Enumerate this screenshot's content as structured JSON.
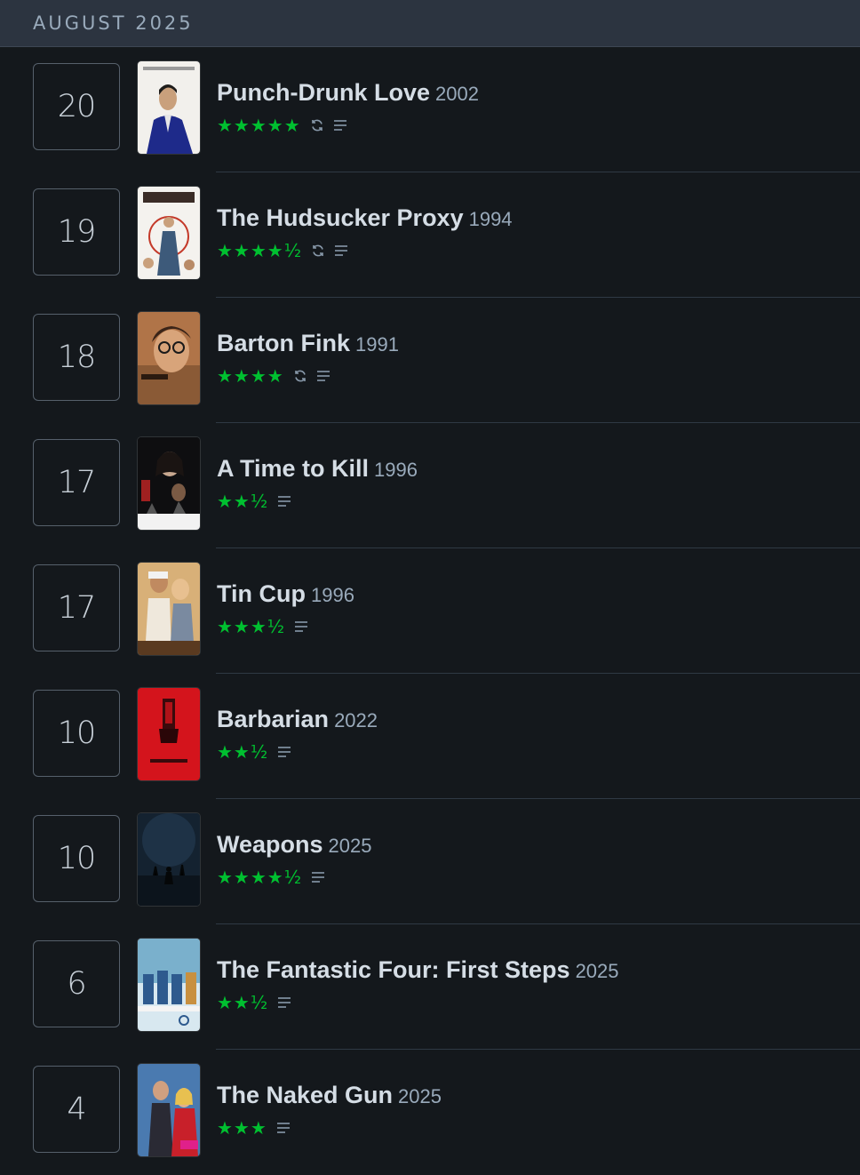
{
  "diary": {
    "month_label": "AUGUST 2025",
    "entries": [
      {
        "day": "20",
        "title": "Punch-Drunk Love",
        "year": "2002",
        "stars": "★★★★★",
        "rating": 5.0,
        "rewatch": true,
        "has_review": true
      },
      {
        "day": "19",
        "title": "The Hudsucker Proxy",
        "year": "1994",
        "stars": "★★★★½",
        "rating": 4.5,
        "rewatch": true,
        "has_review": true
      },
      {
        "day": "18",
        "title": "Barton Fink",
        "year": "1991",
        "stars": "★★★★",
        "rating": 4.0,
        "rewatch": true,
        "has_review": true
      },
      {
        "day": "17",
        "title": "A Time to Kill",
        "year": "1996",
        "stars": "★★½",
        "rating": 2.5,
        "rewatch": false,
        "has_review": true
      },
      {
        "day": "17",
        "title": "Tin Cup",
        "year": "1996",
        "stars": "★★★½",
        "rating": 3.5,
        "rewatch": false,
        "has_review": true
      },
      {
        "day": "10",
        "title": "Barbarian",
        "year": "2022",
        "stars": "★★½",
        "rating": 2.5,
        "rewatch": false,
        "has_review": true
      },
      {
        "day": "10",
        "title": "Weapons",
        "year": "2025",
        "stars": "★★★★½",
        "rating": 4.5,
        "rewatch": false,
        "has_review": true
      },
      {
        "day": "6",
        "title": "The Fantastic Four: First Steps",
        "year": "2025",
        "stars": "★★½",
        "rating": 2.5,
        "rewatch": false,
        "has_review": true
      },
      {
        "day": "4",
        "title": "The Naked Gun",
        "year": "2025",
        "stars": "★★★",
        "rating": 3.0,
        "rewatch": false,
        "has_review": true
      }
    ]
  },
  "colors": {
    "background": "#14181c",
    "header_bg": "#2c3440",
    "star_green": "#00c030",
    "title_text": "#d5dde5",
    "muted_text": "#99aabb",
    "icon_gray": "#8899aa"
  }
}
